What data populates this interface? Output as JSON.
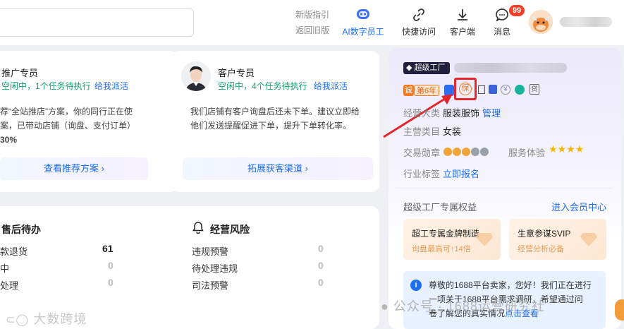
{
  "header": {
    "new_guide": "新版指引",
    "back_old": "返回旧版",
    "nav": [
      {
        "label": "AI数字员工",
        "icon": "ai-robot-icon"
      },
      {
        "label": "快捷访问",
        "icon": "link-icon"
      },
      {
        "label": "客户端",
        "icon": "download-icon"
      },
      {
        "label": "消息",
        "icon": "message-icon"
      }
    ],
    "message_badge": "99"
  },
  "promo_agent": {
    "title": "推广专员",
    "status": "空闲中，1个任务待执行",
    "dispatch": "给我派活",
    "desc_line1": "荐“全站推店”方案，你的同行正在使",
    "desc_line2": "案，已带动店铺（询盘、支付订单）",
    "desc_line3": "30%",
    "action": "查看推荐方案"
  },
  "customer_agent": {
    "title": "客户专员",
    "status": "空闲中，4个任务待执行",
    "dispatch": "给我派活",
    "desc_line1": "我们店铺有客户询盘后还未下单。建议立即给",
    "desc_line2": "他们发送提醒促进下单，提升下单转化率。",
    "action": "拓展获客渠道"
  },
  "after_sales": {
    "title": "售后待办",
    "rows": [
      {
        "label": "款退货",
        "value": "61"
      },
      {
        "label": "中",
        "value": "0"
      },
      {
        "label": "处理",
        "value": "0"
      }
    ]
  },
  "risk": {
    "title": "经营风险",
    "rows": [
      {
        "label": "违规预警",
        "value": "0"
      },
      {
        "label": "待处理违规",
        "value": "0"
      },
      {
        "label": "司法预警",
        "value": "0"
      }
    ]
  },
  "shop": {
    "level": "超级工厂",
    "years": "第6年",
    "cheng": "诚",
    "business_label": "经营大类",
    "business_value": "服装服饰",
    "manage": "管理",
    "main_label": "主营类目",
    "main_value": "女装",
    "medal_label": "交易勋章",
    "service_label": "服务体验",
    "medals_lit": 3,
    "medals_total": 5,
    "stars": 4,
    "industry_label": "行业标签",
    "industry_action": "立即报名",
    "badge_icons": [
      "guarantee-icon",
      "certified-icon",
      "doc-icon",
      "shield-icon",
      "yuan-icon",
      "card-icon",
      "loan-icon"
    ]
  },
  "benefits": {
    "title": "超级工厂专属权益",
    "link": "进入会员中心",
    "items": [
      {
        "title": "超工专属金牌制造",
        "sub": "询盘最高可↑14倍"
      },
      {
        "title": "生意参谋SVIP",
        "sub": "经营分析必备"
      }
    ]
  },
  "notice": {
    "line1": "尊敬的1688平台卖家，您好！我们正在进行",
    "line2": "一项关于1688平台需求调研，希望通过问",
    "line3": "卷了解您的真实情况",
    "link": "点击查看"
  },
  "watermarks": {
    "left": "大数跨境",
    "right": "公众号 · 1688运营研究社"
  },
  "colors": {
    "accent": "#1d6ef2",
    "green": "#12a06b",
    "badge": "#f4402b",
    "star": "#f5b800",
    "annotation": "#e5242b"
  }
}
